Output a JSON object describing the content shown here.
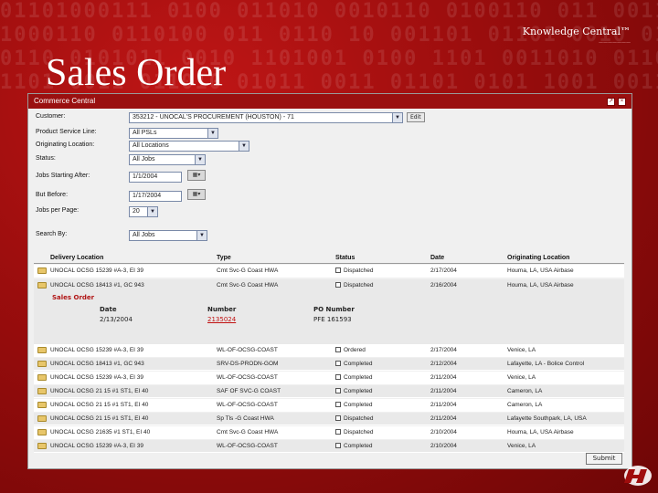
{
  "branding": {
    "name": "Knowledge Central™",
    "colors": {
      "background": "#9a0d0d",
      "titlebar": "#9a1010",
      "link": "#c01010"
    }
  },
  "slide_title": "Sales Order",
  "window": {
    "title": "Commerce Central",
    "icons": [
      "export-icon",
      "close-icon"
    ]
  },
  "form": {
    "customer": {
      "label": "Customer:",
      "value": "353212 - UNOCAL'S PROCUREMENT (HOUSTON) - 71",
      "button": "Edit"
    },
    "product_service_line": {
      "label": "Product Service Line:",
      "value": "All PSLs"
    },
    "originating_location": {
      "label": "Originating Location:",
      "value": "All Locations"
    },
    "status": {
      "label": "Status:",
      "value": "All Jobs"
    },
    "jobs_starting_after": {
      "label": "Jobs Starting After:",
      "value": "1/1/2004"
    },
    "but_before": {
      "label": "But Before:",
      "value": "1/17/2004"
    },
    "jobs_per_page": {
      "label": "Jobs per Page:",
      "value": "20"
    },
    "search_by": {
      "label": "Search By:",
      "value": "All Jobs"
    }
  },
  "grid": {
    "columns": [
      "Delivery Location",
      "Type",
      "Status",
      "Date",
      "Originating Location"
    ],
    "rows": [
      [
        "UNOCAL OCSG 15239 #A-3, EI 39",
        "Cmt Svc-G Coast HWA",
        "Dispatched",
        "2/17/2004",
        "Houma, LA, USA Airbase"
      ],
      [
        "UNOCAL OCSG 18413 #1, GC 943",
        "Cmt Svc-G Coast HWA",
        "Dispatched",
        "2/16/2004",
        "Houma, LA, USA Airbase"
      ]
    ],
    "detail": {
      "title": "Sales Order",
      "headers": [
        "Date",
        "Number",
        "PO Number"
      ],
      "values": [
        "2/13/2004",
        "2135024",
        "PFE 161593"
      ]
    },
    "rows_after": [
      [
        "UNOCAL OCSG 15239 #A-3, EI 39",
        "WL-OF-OCSG-COAST",
        "Ordered",
        "2/17/2004",
        "Venice, LA"
      ],
      [
        "UNOCAL OCSG 18413 #1, GC 943",
        "SRV-DS-PRODN-GOM",
        "Completed",
        "2/12/2004",
        "Lafayette, LA - Bolice Control"
      ],
      [
        "UNOCAL OCSG 15239 #A-3, EI 39",
        "WL-OF-OCSG-COAST",
        "Completed",
        "2/11/2004",
        "Venice, LA"
      ],
      [
        "UNOCAL OCSG 21 15 #1 ST1, EI 40",
        "SAF OF SVC-G COAST",
        "Completed",
        "2/11/2004",
        "Cameron, LA"
      ],
      [
        "UNOCAL OCSG 21 15 #1 ST1, EI 40",
        "WL-OF-OCSG-COAST",
        "Completed",
        "2/11/2004",
        "Cameron, LA"
      ],
      [
        "UNOCAL OCSG 21 15 #1 ST1, EI 40",
        "Sp Tls -G Coast HWA",
        "Dispatched",
        "2/11/2004",
        "Lafayette Southpark, LA, USA"
      ],
      [
        "UNOCAL OCSG 21635 #1 ST1, EI 40",
        "Cmt Svc-G Coast HWA",
        "Dispatched",
        "2/10/2004",
        "Houma, LA, USA Airbase"
      ],
      [
        "UNOCAL OCSG 15239 #A-3, EI 39",
        "WL-OF-OCSG-COAST",
        "Completed",
        "2/10/2004",
        "Venice, LA"
      ]
    ]
  },
  "submit_label": "Submit"
}
